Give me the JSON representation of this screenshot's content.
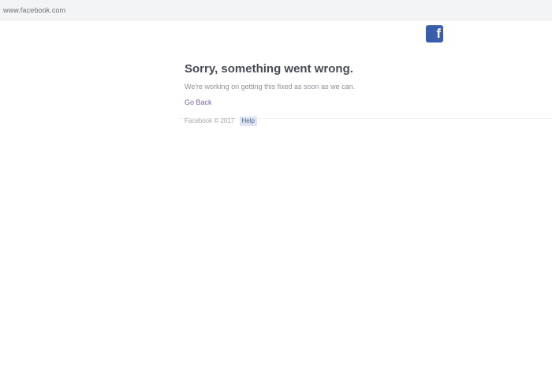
{
  "browser": {
    "address": "www.facebook.com"
  },
  "logo": {
    "glyph": "f",
    "brand_color": "#3b5bab",
    "icon": "facebook-logo-icon"
  },
  "error": {
    "title": "Sorry, something went wrong.",
    "message": "We're working on getting this fixed as soon as we can.",
    "go_back": "Go Back"
  },
  "footer": {
    "copyright": "Facebook © 2017",
    "help": "Help"
  }
}
